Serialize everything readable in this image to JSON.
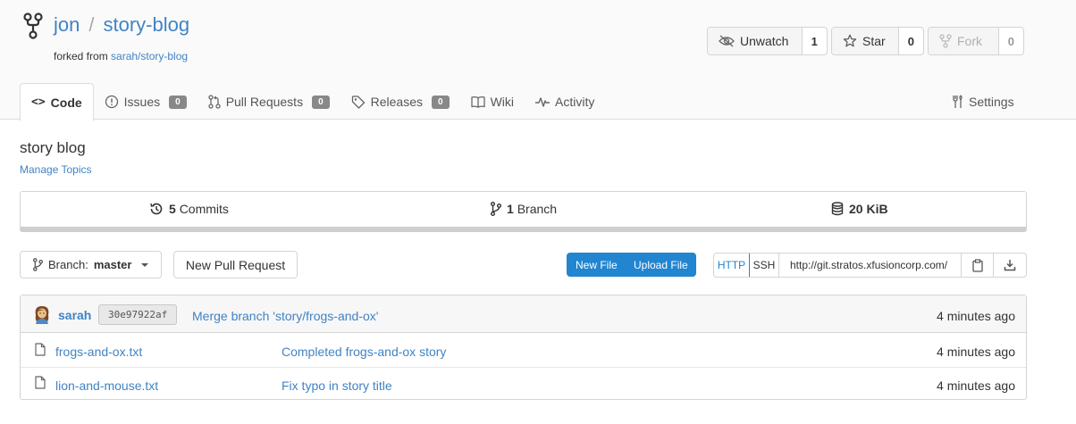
{
  "repo": {
    "owner": "jon",
    "separator": "/",
    "name": "story-blog",
    "forked_prefix": "forked from ",
    "forked_from": "sarah/story-blog"
  },
  "header_buttons": {
    "watch": {
      "label": "Unwatch",
      "count": "1"
    },
    "star": {
      "label": "Star",
      "count": "0"
    },
    "fork": {
      "label": "Fork",
      "count": "0"
    }
  },
  "tabs": [
    {
      "label": "Code"
    },
    {
      "label": "Issues",
      "badge": "0"
    },
    {
      "label": "Pull Requests",
      "badge": "0"
    },
    {
      "label": "Releases",
      "badge": "0"
    },
    {
      "label": "Wiki"
    },
    {
      "label": "Activity"
    }
  ],
  "settings_label": "Settings",
  "description": "story blog",
  "manage_topics": "Manage Topics",
  "stats": {
    "commits_count": "5",
    "commits_label": "Commits",
    "branches_count": "1",
    "branches_label": "Branch",
    "size": "20 KiB"
  },
  "toolbar": {
    "branch_prefix": "Branch:",
    "branch_name": "master",
    "new_pr": "New Pull Request",
    "new_file": "New File",
    "upload_file": "Upload File",
    "http": "HTTP",
    "ssh": "SSH",
    "clone_url": "http://git.stratos.xfusioncorp.com/"
  },
  "latest_commit": {
    "author": "sarah",
    "sha": "30e97922af",
    "message": "Merge branch 'story/frogs-and-ox'",
    "time": "4 minutes ago"
  },
  "files": [
    {
      "name": "frogs-and-ox.txt",
      "message": "Completed frogs-and-ox story",
      "time": "4 minutes ago"
    },
    {
      "name": "lion-and-mouse.txt",
      "message": "Fix typo in story title",
      "time": "4 minutes ago"
    }
  ]
}
